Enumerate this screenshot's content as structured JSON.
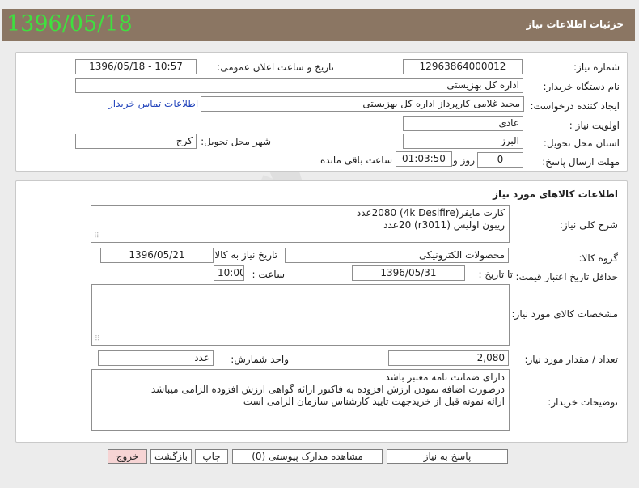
{
  "header": {
    "date": "1396/05/18",
    "title": "جزئیات اطلاعات نیاز"
  },
  "need_info": {
    "need_number_label": "شماره نیاز:",
    "need_number": "12963864000012",
    "announce_label": "تاریخ و ساعت اعلان عمومی:",
    "announce_value": "1396/05/18 - 10:57",
    "buyer_org_label": "نام دستگاه خریدار:",
    "buyer_org": "اداره کل بهزیستی",
    "creator_label": "ایجاد کننده درخواست:",
    "creator": "مجید غلامی کارپرداز اداره کل بهزیستی",
    "contact_link": "اطلاعات تماس خریدار",
    "priority_label": "اولویت نیاز :",
    "priority": "عادی",
    "province_label": "استان محل تحویل:",
    "province": "البرز",
    "city_label": "شهر محل تحویل:",
    "city": "کرج",
    "deadline_label": "مهلت ارسال پاسخ:",
    "days": "0",
    "days_unit": "روز و",
    "time_left": "01:03:50",
    "time_left_suffix": "ساعت باقی مانده"
  },
  "goods": {
    "section_title": "اطلاعات کالاهای مورد نیاز",
    "summary_label": "شرح کلی نیاز:",
    "summary_line1": "کارت مایفر(4k Desifire) 2080عدد",
    "summary_line2": "ریبون اولیس (r3011)     20عدد",
    "group_label": "گروه کالا:",
    "group": "محصولات الکترونیکی",
    "need_date_label": "تاریخ نیاز به کالا:",
    "need_date": "1396/05/21",
    "validity_label": "حداقل تاریخ اعتبار قیمت:",
    "until_label": "تا تاریخ :",
    "validity_date": "1396/05/31",
    "hour_label": "ساعت :",
    "hour": "10:00",
    "specs_label": "مشخصات کالای مورد نیاز:",
    "qty_label": "تعداد / مقدار مورد نیاز:",
    "qty": "2,080",
    "unit_label": "واحد شمارش:",
    "unit": "عدد",
    "notes_label": "توضیحات خریدار:",
    "notes_line1": "دارای ضمانت نامه معتبر باشد",
    "notes_line2": "درصورت اضافه نمودن ارزش افزوده به فاکتور ارائه گواهی ارزش افزوده الزامی میباشد",
    "notes_line3": "ارائه نمونه قبل از خریدجهت تایید کارشناس سازمان الزامی است"
  },
  "buttons": {
    "reply": "پاسخ به نیاز",
    "attachments": "مشاهده مدارک پیوستی (0)",
    "print": "چاپ",
    "back": "بازگشت",
    "exit": "خروج"
  },
  "colors": {
    "header_bg": "#8b7663",
    "date_green": "#3fe03f",
    "link_blue": "#2244bb",
    "exit_bg": "#f6d4d4"
  }
}
